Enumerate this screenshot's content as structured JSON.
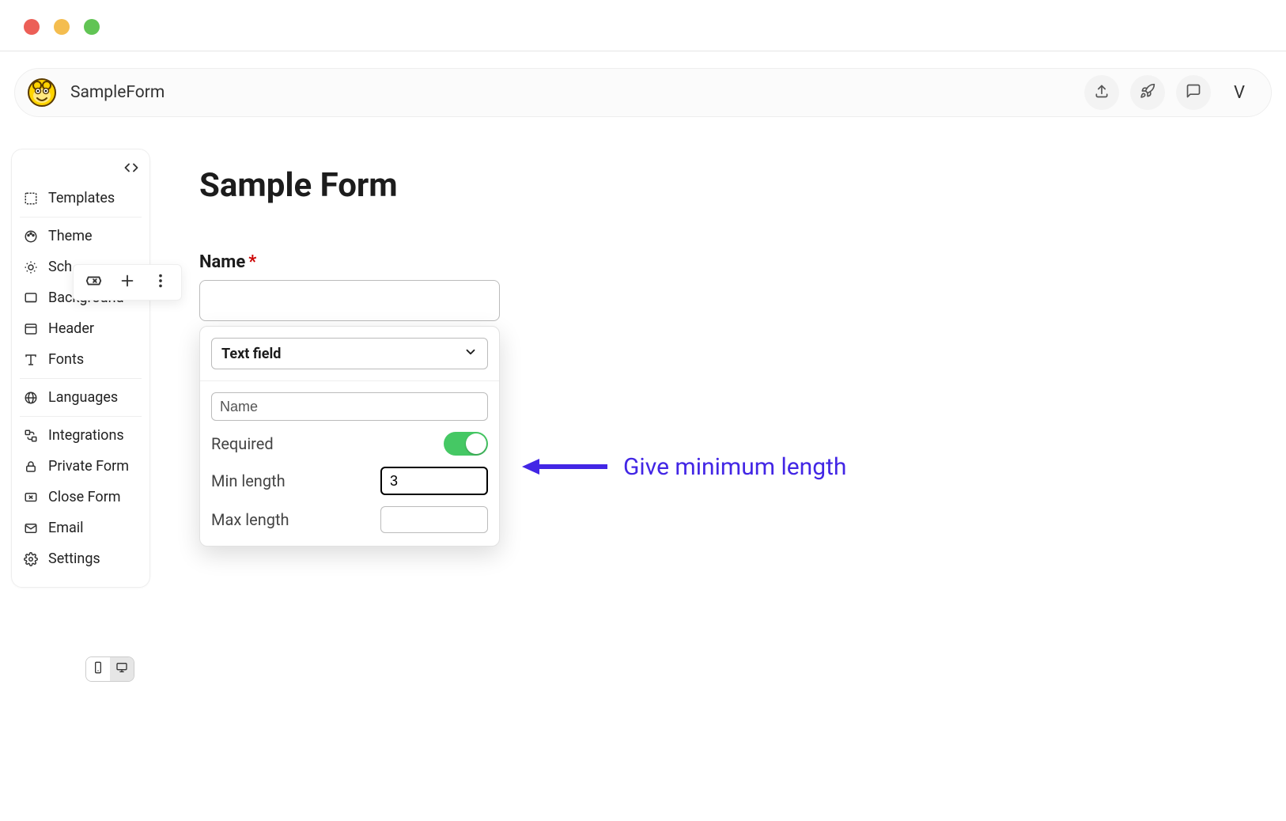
{
  "topbar": {
    "doc_title": "SampleForm",
    "avatar_letter": "V"
  },
  "sidebar": {
    "items": [
      {
        "label": "Templates"
      },
      {
        "label": "Theme"
      },
      {
        "label": "Sch"
      },
      {
        "label": "Background"
      },
      {
        "label": "Header"
      },
      {
        "label": "Fonts"
      },
      {
        "label": "Languages"
      },
      {
        "label": "Integrations"
      },
      {
        "label": "Private Form"
      },
      {
        "label": "Close Form"
      },
      {
        "label": "Email"
      },
      {
        "label": "Settings"
      }
    ]
  },
  "form": {
    "title": "Sample Form",
    "field_label": "Name",
    "field_value": ""
  },
  "popover": {
    "type_label": "Text field",
    "name_value": "Name",
    "required_label": "Required",
    "required_on": true,
    "min_label": "Min length",
    "min_value": "3",
    "max_label": "Max length",
    "max_value": ""
  },
  "annotation": {
    "text": "Give minimum length"
  }
}
